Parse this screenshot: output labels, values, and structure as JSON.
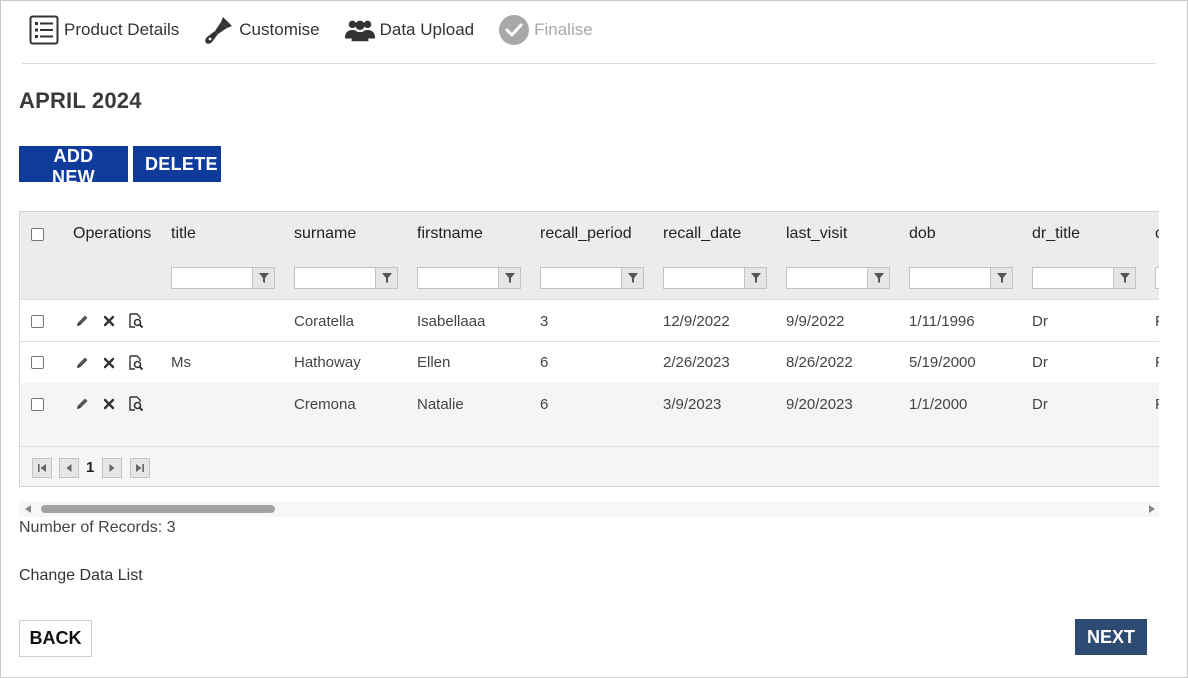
{
  "steps": [
    {
      "label": "Product Details",
      "icon": "list-icon",
      "state": "done"
    },
    {
      "label": "Customise",
      "icon": "paintbrush-icon",
      "state": "done"
    },
    {
      "label": "Data Upload",
      "icon": "users-icon",
      "state": "active"
    },
    {
      "label": "Finalise",
      "icon": "check-circle-icon",
      "state": "disabled"
    }
  ],
  "page": {
    "title": "APRIL 2024"
  },
  "toolbar": {
    "add_label": "ADD NEW",
    "delete_label": "DELETE"
  },
  "colors": {
    "primary": "#0e3b9c",
    "next": "#2c4a72",
    "disabled": "#a8a8a8",
    "header_bg": "#ececec"
  },
  "grid": {
    "columns": [
      "Operations",
      "title",
      "surname",
      "firstname",
      "recall_period",
      "recall_date",
      "last_visit",
      "dob",
      "dr_title",
      "c"
    ],
    "rows": [
      {
        "title": "",
        "surname": "Coratella",
        "firstname": "Isabellaaa",
        "recall_period": "3",
        "recall_date": "12/9/2022",
        "last_visit": "9/9/2022",
        "dob": "1/11/1996",
        "dr_title": "Dr",
        "next": "F"
      },
      {
        "title": "Ms",
        "surname": "Hathoway",
        "firstname": "Ellen",
        "recall_period": "6",
        "recall_date": "2/26/2023",
        "last_visit": "8/26/2022",
        "dob": "5/19/2000",
        "dr_title": "Dr",
        "next": "F"
      },
      {
        "title": "",
        "surname": "Cremona",
        "firstname": "Natalie",
        "recall_period": "6",
        "recall_date": "3/9/2023",
        "last_visit": "9/20/2023",
        "dob": "1/1/2000",
        "dr_title": "Dr",
        "next": "F"
      }
    ],
    "pager": {
      "current_page": "1"
    }
  },
  "footer": {
    "records_label": "Number of Records: 3",
    "change_link": "Change Data List",
    "back_label": "BACK",
    "next_label": "NEXT"
  }
}
